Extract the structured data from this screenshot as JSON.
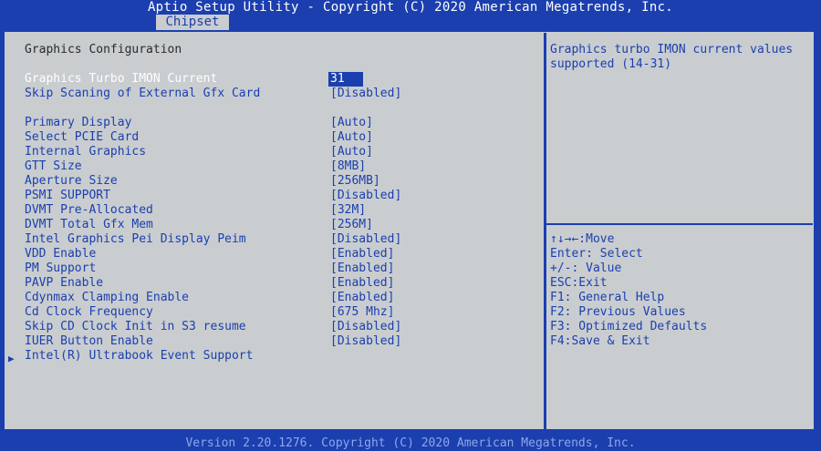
{
  "header": {
    "title": "Aptio Setup Utility - Copyright (C) 2020 American Megatrends, Inc.",
    "tab": "Chipset"
  },
  "section": {
    "heading": "Graphics Configuration",
    "submenu_arrow": "▶",
    "items": [
      {
        "label": "Graphics Turbo IMON Current",
        "value": "31"
      },
      {
        "label": "Skip Scaning of External Gfx Card",
        "value": "[Disabled]"
      },
      {
        "label": "Primary Display",
        "value": "[Auto]"
      },
      {
        "label": "Select PCIE Card",
        "value": "[Auto]"
      },
      {
        "label": "Internal Graphics",
        "value": "[Auto]"
      },
      {
        "label": "GTT Size",
        "value": "[8MB]"
      },
      {
        "label": "Aperture Size",
        "value": "[256MB]"
      },
      {
        "label": "PSMI SUPPORT",
        "value": "[Disabled]"
      },
      {
        "label": "DVMT Pre-Allocated",
        "value": "[32M]"
      },
      {
        "label": "DVMT Total Gfx Mem",
        "value": "[256M]"
      },
      {
        "label": "Intel Graphics Pei Display Peim",
        "value": "[Disabled]"
      },
      {
        "label": "VDD Enable",
        "value": "[Enabled]"
      },
      {
        "label": "PM Support",
        "value": "[Enabled]"
      },
      {
        "label": "PAVP Enable",
        "value": "[Enabled]"
      },
      {
        "label": "Cdynmax Clamping Enable",
        "value": "[Enabled]"
      },
      {
        "label": "Cd Clock Frequency",
        "value": "[675 Mhz]"
      },
      {
        "label": "Skip CD Clock Init in S3 resume",
        "value": "[Disabled]"
      },
      {
        "label": "IUER Button Enable",
        "value": "[Disabled]"
      },
      {
        "label": "Intel(R) Ultrabook Event Support",
        "value": ""
      }
    ]
  },
  "help": {
    "text": "Graphics turbo IMON current values supported (14-31)"
  },
  "keys": [
    "↑↓→←:Move",
    "Enter: Select",
    "+/-: Value",
    "ESC:Exit",
    "F1: General Help",
    "F2: Previous Values",
    "F3: Optimized Defaults",
    "F4:Save & Exit"
  ],
  "footer": {
    "version": "Version 2.20.1276. Copyright (C) 2020 American Megatrends, Inc."
  },
  "colors": {
    "background": "#1b3fae",
    "panel": "#c9cdd0",
    "text_blue": "#1b3fae",
    "highlight_text": "#ffffff"
  }
}
